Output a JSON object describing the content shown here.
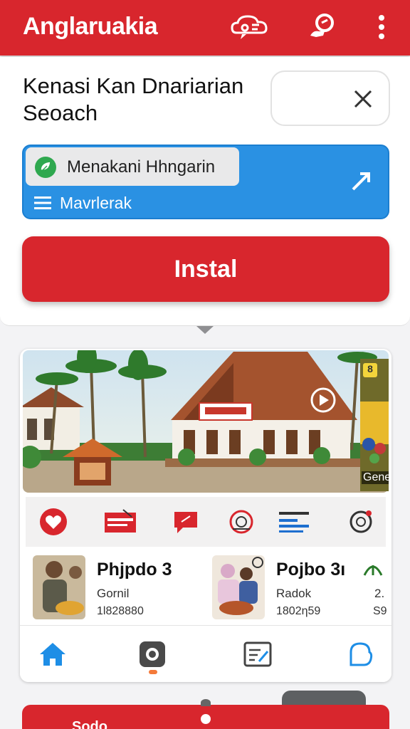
{
  "appbar": {
    "title": "Anglaruakia"
  },
  "header": {
    "heading": "Kenasi Kan Dnariarian Seoach"
  },
  "panel": {
    "chip_text": "Menakani Hhngarin",
    "label": "Mavrlerak"
  },
  "install": {
    "label": "Instal"
  },
  "banner": {
    "side_badge": "8",
    "side_label": "Genes"
  },
  "items": [
    {
      "name": "Phjpdo 3",
      "sub": "Gornil",
      "num": "1l828880",
      "extra": ""
    },
    {
      "name": "Pojbo 3ı",
      "sub": "Radok",
      "num": "1802ƞ59",
      "extra_top": "2.",
      "extra_bottom": "S9"
    }
  ],
  "bottom_bar": {
    "label": "Sodo"
  },
  "colors": {
    "brand_red": "#d8262d",
    "blue": "#2a91e3",
    "nav_blue": "#1e8ee6"
  }
}
